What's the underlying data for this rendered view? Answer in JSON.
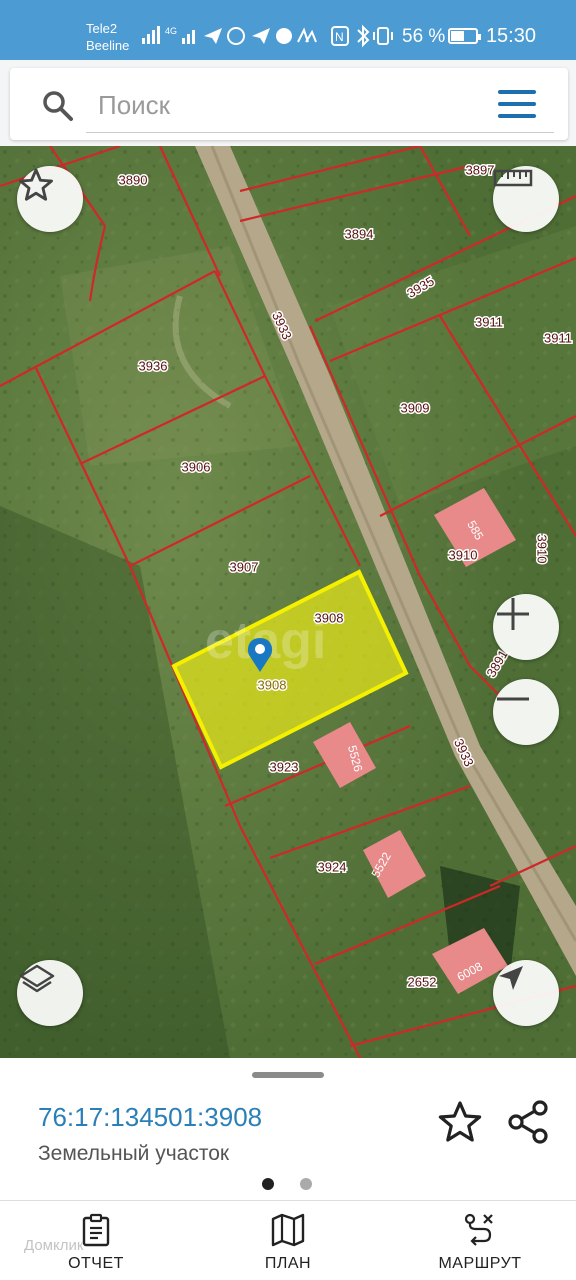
{
  "status_bar": {
    "carrier_1": "Tele2",
    "carrier_2": "Beeline",
    "network_badge": "4G",
    "battery_text": "56 %",
    "battery_level": 0.56,
    "time": "15:30"
  },
  "search": {
    "placeholder": "Поиск"
  },
  "map": {
    "watermark": "etagi",
    "selected_parcel_label": "3908",
    "parcel_labels": [
      "3890",
      "3897",
      "3894",
      "3935",
      "3911",
      "3911",
      "3933",
      "3936",
      "3909",
      "3906",
      "3910",
      "3910",
      "3907",
      "3908",
      "3891",
      "3923",
      "3933",
      "5526",
      "3924",
      "5522",
      "2652",
      "6008"
    ],
    "colors": {
      "parcel_line": "#d02828",
      "selected_fill": "#e6e61a",
      "selected_border": "#f5f000",
      "building_fill": "#e88a8a",
      "road": "#b8aa8c"
    }
  },
  "sheet": {
    "cadastral_number": "76:17:134501:3908",
    "land_type": "Земельный участок",
    "pager_active": 0,
    "pager_count": 2
  },
  "nav": {
    "report_label": "ОТЧЕТ",
    "plan_label": "ПЛАН",
    "route_label": "МАРШРУТ"
  },
  "footer_watermark": "Домклик"
}
